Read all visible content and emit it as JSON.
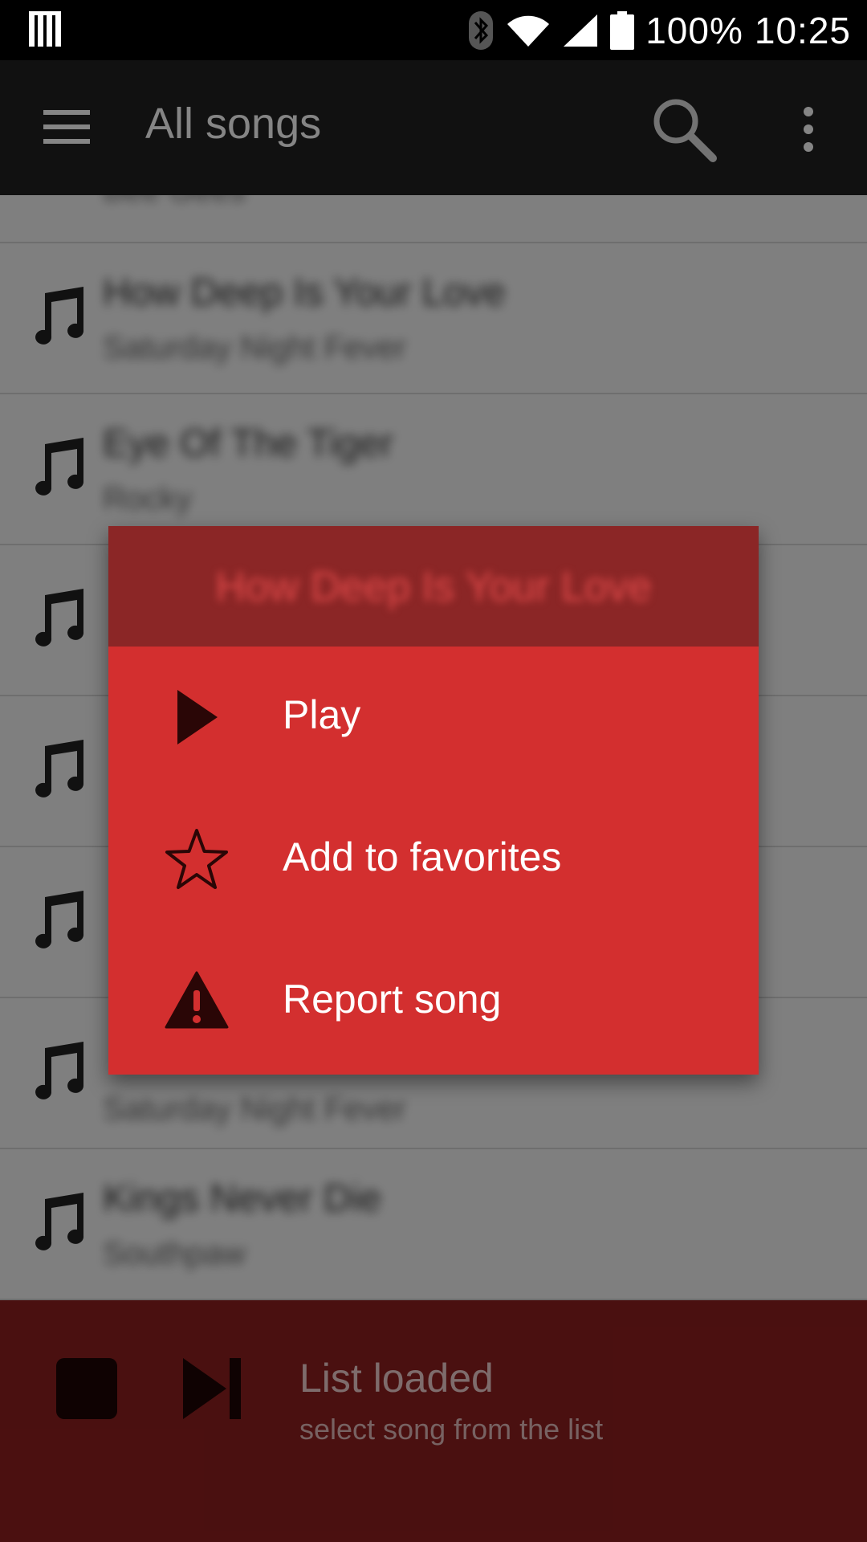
{
  "status_bar": {
    "battery": "100%",
    "time": "10:25"
  },
  "app_bar": {
    "title": "All songs",
    "icons": [
      "menu-icon",
      "search-icon",
      "more-vert-icon"
    ]
  },
  "song_list": {
    "items": [
      {
        "title": "",
        "artist": "Bee Gees"
      },
      {
        "title": "How Deep Is Your Love",
        "artist": "Saturday Night Fever"
      },
      {
        "title": "Eye Of The Tiger",
        "artist": "Rocky"
      },
      {
        "title": "",
        "artist": ""
      },
      {
        "title": "",
        "artist": ""
      },
      {
        "title": "",
        "artist": ""
      },
      {
        "title": "",
        "artist": "Saturday Night Fever"
      },
      {
        "title": "Kings Never Die",
        "artist": "Southpaw"
      }
    ]
  },
  "dialog": {
    "header": "How Deep Is Your Love",
    "items": [
      {
        "label": "Play",
        "icon": "play-icon"
      },
      {
        "label": "Add to favorites",
        "icon": "star-outline-icon"
      },
      {
        "label": "Report song",
        "icon": "warning-icon"
      }
    ]
  },
  "player": {
    "status_title": "List loaded",
    "status_subtitle": "select song from the list"
  },
  "colors": {
    "accent": "#d32f2f",
    "dialog_header": "#8b2626",
    "player_bar": "#8f1f1f"
  }
}
